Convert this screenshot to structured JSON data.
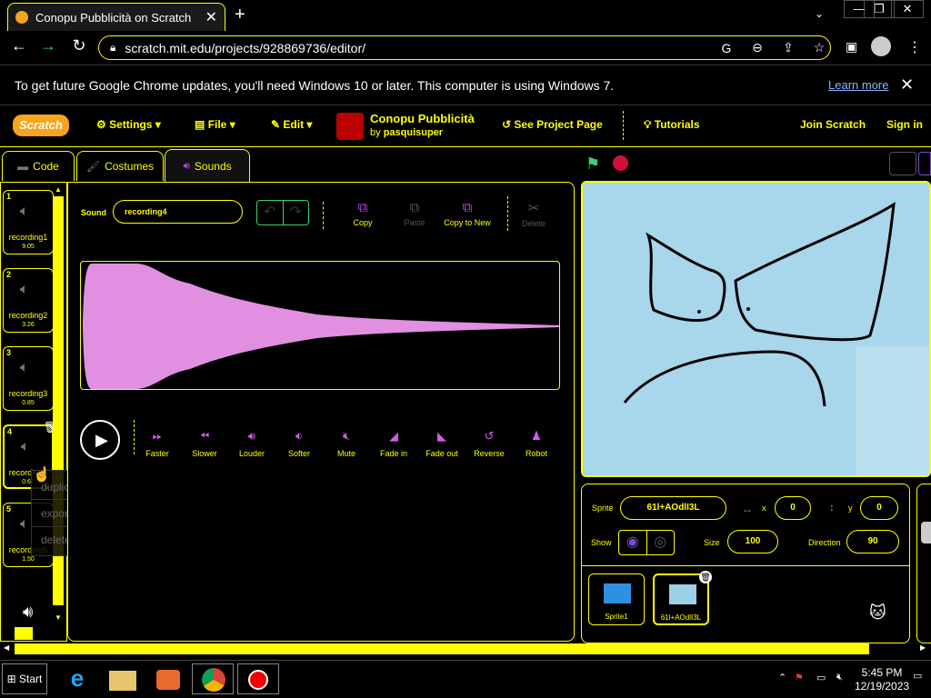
{
  "browser": {
    "tab_title": "Conopu Pubblicità on Scratch",
    "url": "scratch.mit.edu/projects/928869736/editor/",
    "window_controls": [
      "minimize",
      "restore",
      "close"
    ]
  },
  "infobar": {
    "message": "To get future Google Chrome updates, you'll need Windows 10 or later. This computer is using Windows 7.",
    "learn_more": "Learn more"
  },
  "menubar": {
    "logo": "Scratch",
    "settings": "Settings",
    "file": "File",
    "edit": "Edit",
    "project_title": "Conopu Pubblicità",
    "by_prefix": "by",
    "author": "pasquisuper",
    "see_project_page": "See Project Page",
    "tutorials": "Tutorials",
    "join": "Join Scratch",
    "sign_in": "Sign in"
  },
  "editor_tabs": [
    "Code",
    "Costumes",
    "Sounds"
  ],
  "sounds": [
    {
      "num": "1",
      "name": "recording1",
      "duration": "9.05"
    },
    {
      "num": "2",
      "name": "recording2",
      "duration": "3.26"
    },
    {
      "num": "3",
      "name": "recording3",
      "duration": "0.85"
    },
    {
      "num": "4",
      "name": "recording4",
      "duration": "0.61"
    },
    {
      "num": "5",
      "name": "recording5",
      "duration": "1.50"
    }
  ],
  "context_menu": [
    "duplicate",
    "export",
    "delete"
  ],
  "sound_editor": {
    "sound_label": "Sound",
    "sound_name": "recording4",
    "copy": "Copy",
    "paste": "Paste",
    "copy_to_new": "Copy to New",
    "delete": "Delete"
  },
  "effects": [
    "Faster",
    "Slower",
    "Louder",
    "Softer",
    "Mute",
    "Fade in",
    "Fade out",
    "Reverse",
    "Robot"
  ],
  "sprite_info": {
    "sprite_label": "Sprite",
    "sprite_name": "61l+AOdlI3L",
    "x_label": "x",
    "x": "0",
    "y_label": "y",
    "y": "0",
    "show_label": "Show",
    "size_label": "Size",
    "size": "100",
    "direction_label": "Direction",
    "direction": "90"
  },
  "sprites": [
    {
      "name": "Sprite1"
    },
    {
      "name": "61l+AOdlI3L"
    }
  ],
  "taskbar": {
    "start": "Start",
    "time": "5:45 PM",
    "date": "12/19/2023"
  },
  "colors": {
    "accent": "#ffff00",
    "waveform": "#e18fe0",
    "effect_icon": "#d05ce8",
    "stage_bg": "#9dcfe6"
  }
}
